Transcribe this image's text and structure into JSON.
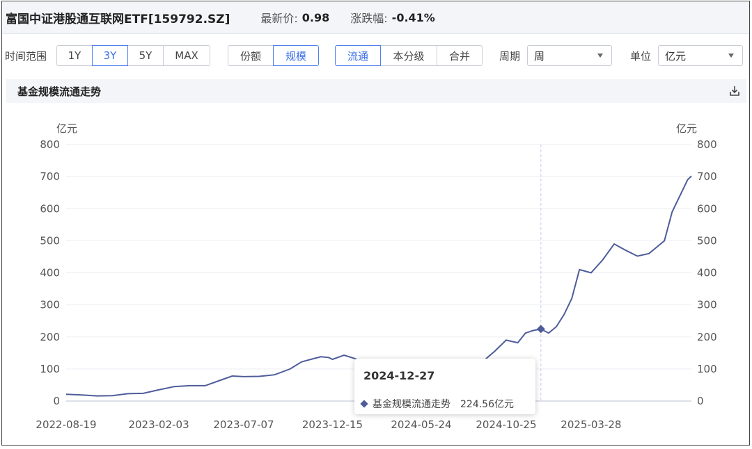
{
  "header": {
    "fund_name": "富国中证港股通互联网ETF[159792.SZ]",
    "price_label": "最新价:",
    "price_value": "0.98",
    "change_label": "涨跌幅:",
    "change_value": "-0.41%"
  },
  "controls": {
    "range_label": "时间范围",
    "range_buttons": [
      "1Y",
      "3Y",
      "5Y",
      "MAX"
    ],
    "range_active": "3Y",
    "metric_buttons": [
      "份额",
      "规模"
    ],
    "metric_active": "规模",
    "share_buttons": [
      "流通",
      "本分级",
      "合并"
    ],
    "share_active": "流通",
    "period_label": "周期",
    "period_value": "周",
    "unit_label": "单位",
    "unit_value": "亿元"
  },
  "section": {
    "title": "基金规模流通走势"
  },
  "tooltip": {
    "date": "2024-12-27",
    "series": "基金规模流通走势",
    "value": "224.56亿元"
  },
  "chart_data": {
    "type": "line",
    "ylabel_left": "亿元",
    "ylabel_right": "亿元",
    "ylim": [
      0,
      800
    ],
    "yticks": [
      0,
      100,
      200,
      300,
      400,
      500,
      600,
      700,
      800
    ],
    "x_tick_labels": [
      "2022-08-19",
      "2023-02-03",
      "2023-07-07",
      "2023-12-15",
      "2024-05-24",
      "2024-10-25",
      "2025-03-28"
    ],
    "grid": true,
    "line_color": "#4e5c9a",
    "highlight": {
      "x": "2024-12-27",
      "y": 224.56
    },
    "series": [
      {
        "name": "基金规模流通走势",
        "points": [
          [
            "2022-08-19",
            21
          ],
          [
            "2022-09-16",
            19
          ],
          [
            "2022-10-14",
            16
          ],
          [
            "2022-11-11",
            17
          ],
          [
            "2022-12-09",
            23
          ],
          [
            "2023-01-06",
            24
          ],
          [
            "2023-02-03",
            35
          ],
          [
            "2023-03-03",
            45
          ],
          [
            "2023-03-31",
            48
          ],
          [
            "2023-04-28",
            48
          ],
          [
            "2023-05-26",
            65
          ],
          [
            "2023-06-16",
            78
          ],
          [
            "2023-07-07",
            76
          ],
          [
            "2023-08-04",
            77
          ],
          [
            "2023-09-01",
            82
          ],
          [
            "2023-09-29",
            100
          ],
          [
            "2023-10-20",
            122
          ],
          [
            "2023-11-10",
            132
          ],
          [
            "2023-11-24",
            138
          ],
          [
            "2023-12-08",
            136
          ],
          [
            "2023-12-15",
            130
          ],
          [
            "2024-01-05",
            143
          ],
          [
            "2024-02-02",
            128
          ],
          [
            "2024-03-01",
            112
          ],
          [
            "2024-03-29",
            100
          ],
          [
            "2024-04-26",
            96
          ],
          [
            "2024-05-24",
            105
          ],
          [
            "2024-06-21",
            110
          ],
          [
            "2024-07-19",
            114
          ],
          [
            "2024-08-16",
            118
          ],
          [
            "2024-09-13",
            124
          ],
          [
            "2024-10-04",
            155
          ],
          [
            "2024-10-25",
            190
          ],
          [
            "2024-11-15",
            182
          ],
          [
            "2024-11-29",
            212
          ],
          [
            "2024-12-13",
            220
          ],
          [
            "2024-12-27",
            224.56
          ],
          [
            "2025-01-10",
            212
          ],
          [
            "2025-01-24",
            232
          ],
          [
            "2025-02-07",
            270
          ],
          [
            "2025-02-21",
            320
          ],
          [
            "2025-03-07",
            410
          ],
          [
            "2025-03-28",
            400
          ],
          [
            "2025-04-18",
            440
          ],
          [
            "2025-05-09",
            490
          ],
          [
            "2025-05-30",
            470
          ],
          [
            "2025-06-20",
            452
          ],
          [
            "2025-07-11",
            460
          ],
          [
            "2025-07-25",
            480
          ],
          [
            "2025-08-08",
            500
          ],
          [
            "2025-08-22",
            590
          ],
          [
            "2025-09-05",
            640
          ],
          [
            "2025-09-19",
            690
          ],
          [
            "2025-09-26",
            702
          ]
        ]
      }
    ]
  }
}
